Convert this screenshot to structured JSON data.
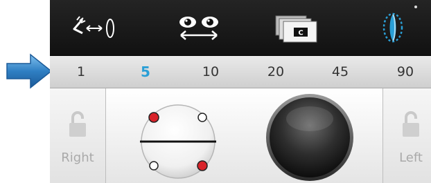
{
  "pointer": {
    "icon": "right-arrow-pointer-icon",
    "color": "#2f7fc3"
  },
  "toolbar": {
    "buttons": [
      {
        "icon": "eye-distance-icon",
        "name": "eye-distance"
      },
      {
        "icon": "eyes-swap-icon",
        "name": "eyes-swap"
      },
      {
        "icon": "cards-c-icon",
        "name": "cards-c"
      },
      {
        "icon": "lens-focus-icon",
        "name": "lens-focus",
        "active_color": "#2a9fd6"
      }
    ]
  },
  "zoom_levels": {
    "values": [
      "1",
      "5",
      "10",
      "20",
      "45",
      "90"
    ],
    "selected": "5",
    "selected_color": "#2a9fd6"
  },
  "controls": {
    "right_label": "Right",
    "left_label": "Left",
    "marker_color": "#d8232a"
  }
}
